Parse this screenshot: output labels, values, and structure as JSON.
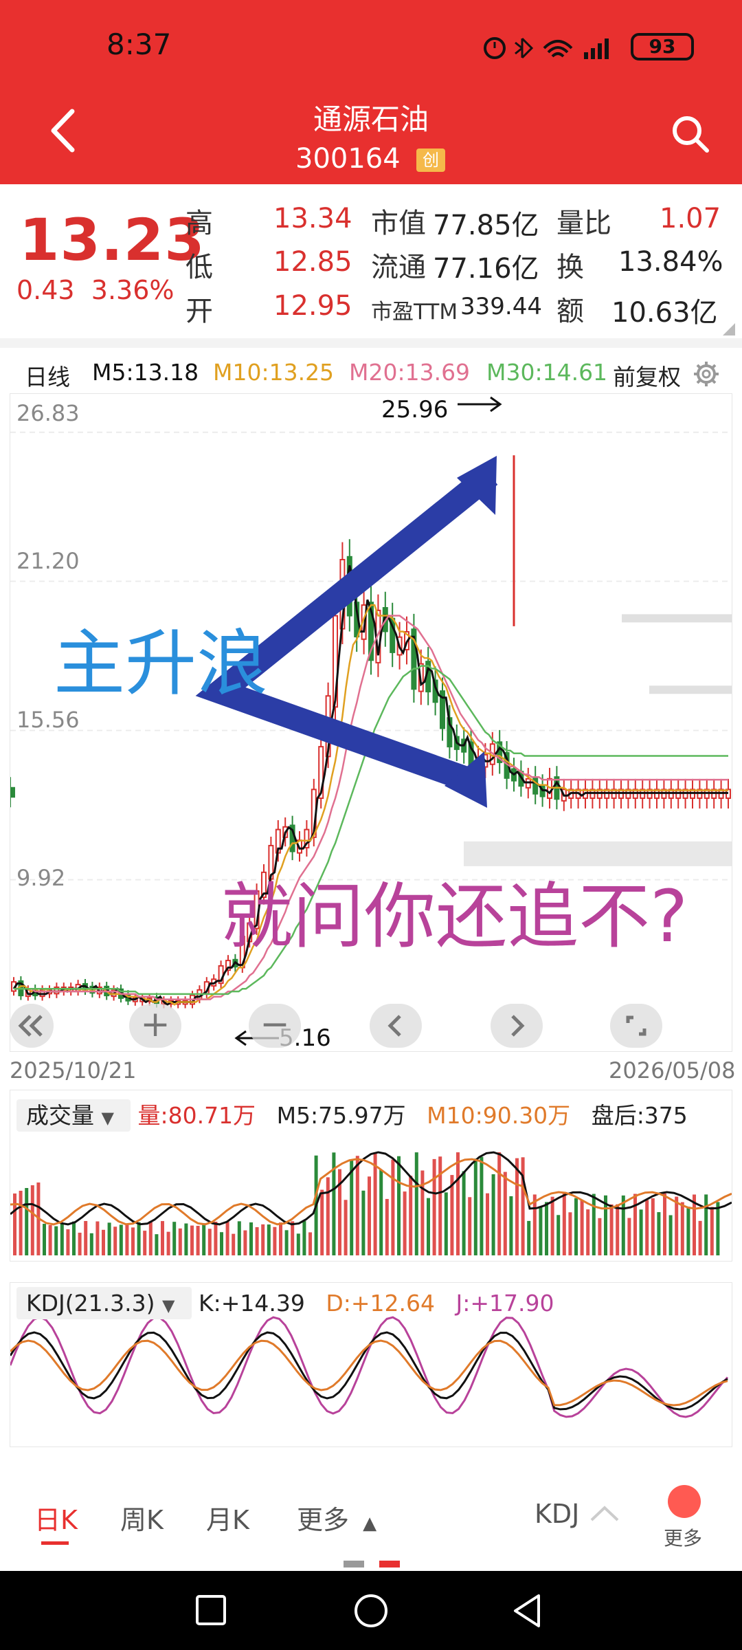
{
  "status": {
    "time": "8:37",
    "battery": "93"
  },
  "header": {
    "title": "通源石油",
    "code": "300164",
    "board_badge": "创"
  },
  "quote": {
    "price": "13.23",
    "change": "0.43",
    "change_pct": "3.36%",
    "high_label": "高",
    "high": "13.34",
    "low_label": "低",
    "low": "12.85",
    "open_label": "开",
    "open": "12.95",
    "mcap_label": "市值",
    "mcap": "77.85亿",
    "float_label": "流通",
    "float": "77.16亿",
    "pe_label": "市盈TTM",
    "pe": "339.44",
    "vol_ratio_label": "量比",
    "vol_ratio": "1.07",
    "turnover_label": "换",
    "turnover": "13.84%",
    "amount_label": "额",
    "amount": "10.63亿"
  },
  "ma_legend": {
    "period": "日线",
    "m5": "M5:13.18",
    "m10": "M10:13.25",
    "m20": "M20:13.69",
    "m30": "M30:14.61",
    "adjust": "前复权"
  },
  "colors": {
    "up": "#d9302e",
    "down": "#2a8a3a",
    "m5": "#111111",
    "m10": "#e0a020",
    "m20": "#e07090",
    "m30": "#5cb85c",
    "brand": "#e8302f"
  },
  "chart_data": {
    "type": "line",
    "title": "",
    "y_ticks": [
      "26.83",
      "21.20",
      "15.56",
      "9.92"
    ],
    "ylim": [
      5.0,
      27.5
    ],
    "x_start_label": "2025/10/21",
    "x_end_label": "2026/05/08",
    "high_marker": "25.96",
    "low_marker": "5.16",
    "annotations": [
      "主升浪",
      "就问你还追不?"
    ],
    "x": [
      0,
      5,
      10,
      15,
      20,
      25,
      30,
      35,
      40,
      45,
      50,
      55,
      60,
      65,
      70,
      75,
      80,
      85,
      90,
      95,
      100,
      105,
      110,
      115,
      120,
      125,
      130,
      135,
      140,
      145,
      150,
      155,
      160,
      165,
      170,
      175,
      180,
      185,
      190,
      195,
      200,
      205,
      210,
      215,
      220,
      225,
      230,
      235,
      240,
      245,
      250,
      255,
      260,
      265,
      270,
      275,
      280,
      285,
      290,
      295,
      300,
      305,
      310,
      315,
      320,
      325,
      330,
      335,
      340,
      345,
      350,
      355,
      360,
      365,
      370,
      375,
      380,
      385,
      390,
      395,
      400,
      405,
      410,
      415,
      420,
      425,
      430,
      435,
      440,
      445,
      450,
      455,
      460,
      465,
      470,
      475,
      480,
      485,
      490,
      495,
      500,
      505,
      510,
      515,
      520,
      525,
      530,
      535,
      540,
      545,
      550,
      555,
      560,
      565,
      570,
      575,
      580,
      585,
      590,
      595,
      600,
      605,
      610,
      615,
      620,
      625,
      630,
      635,
      640,
      645,
      650,
      655,
      660,
      665,
      670,
      675,
      680,
      685,
      690,
      695,
      700,
      705,
      710,
      715,
      720,
      725,
      730,
      735,
      740,
      745,
      750,
      755,
      760,
      765,
      770,
      775,
      780,
      785,
      790,
      795,
      800,
      805,
      810,
      815,
      820,
      825,
      830,
      835,
      840,
      845,
      850,
      855,
      860,
      865,
      870,
      875,
      880,
      885,
      890,
      895,
      900,
      905,
      910,
      915,
      920,
      925,
      930,
      935,
      940,
      945,
      950,
      955,
      960,
      965,
      970,
      975,
      980,
      985,
      990,
      995,
      1000
    ],
    "series": [
      {
        "name": "M5:13.18",
        "color": "#111111",
        "values": [
          5.8,
          6.0,
          6.0,
          5.9,
          5.6,
          5.6,
          5.7,
          5.6,
          5.6,
          5.6,
          5.7,
          5.7,
          5.7,
          5.7,
          5.8,
          5.7,
          5.8,
          5.8,
          5.8,
          5.9,
          5.9,
          5.8,
          5.8,
          5.9,
          5.7,
          5.7,
          5.8,
          5.6,
          5.6,
          5.8,
          5.7,
          5.5,
          5.5,
          5.4,
          5.4,
          5.5,
          5.4,
          5.3,
          5.4,
          5.3,
          5.4,
          5.5,
          5.3,
          5.2,
          5.3,
          5.3,
          5.3,
          5.3,
          5.3,
          5.3,
          5.3,
          5.5,
          5.5,
          5.6,
          5.7,
          6.0,
          6.0,
          6.1,
          6.1,
          6.4,
          6.6,
          6.6,
          6.8,
          6.7,
          6.7,
          7.1,
          7.7,
          8.1,
          8.2,
          9.2,
          9.4,
          9.4,
          10.1,
          10.2,
          11.1,
          11.1,
          11.7,
          11.9,
          11.8,
          11.4,
          11.1,
          11.1,
          11.3,
          11.4,
          11.7,
          13.0,
          13.2,
          13.9,
          14.8,
          16.0,
          16.7,
          18.3,
          19.7,
          21.0,
          21.8,
          21.2,
          20.1,
          19.3,
          19.3,
          20.5,
          20.1,
          19.6,
          18.4,
          19.4,
          19.9,
          19.8,
          19.5,
          19.2,
          18.7,
          18.5,
          18.9,
          19.1,
          19.1,
          18.4,
          17.3,
          17.4,
          17.9,
          17.8,
          17.2,
          16.9,
          16.8,
          16.8,
          15.8,
          15.6,
          15.1,
          15.0,
          15.0,
          15.3,
          14.9,
          14.7,
          14.3,
          14.6,
          14.4,
          14.4,
          14.5,
          14.7,
          14.9,
          14.8,
          14.5,
          14.0,
          13.9,
          14.0,
          13.8,
          13.6,
          13.6,
          13.6,
          13.6,
          13.5,
          13.3,
          13.3,
          13.2,
          13.4,
          13.6,
          13.4,
          13.1,
          13.1,
          13.2,
          13.2,
          13.2,
          13.1,
          13.2,
          13.2,
          13.2,
          13.2,
          13.2,
          13.2,
          13.2,
          13.2,
          13.2,
          13.2,
          13.2,
          13.2,
          13.2,
          13.2,
          13.2,
          13.2,
          13.2,
          13.2,
          13.2,
          13.2,
          13.2,
          13.2,
          13.2,
          13.2,
          13.2,
          13.2,
          13.2,
          13.2,
          13.2,
          13.2,
          13.2,
          13.2,
          13.2,
          13.2,
          13.2,
          13.2,
          13.2,
          13.2,
          13.2,
          13.2,
          13.2,
          13.2,
          13.2,
          13.18
        ]
      },
      {
        "name": "M10:13.25",
        "color": "#e0a020",
        "values": [
          5.8,
          5.8,
          5.9,
          5.9,
          5.8,
          5.7,
          5.8,
          5.7,
          5.7,
          5.8,
          5.7,
          5.7,
          5.7,
          5.7,
          5.7,
          5.8,
          5.7,
          5.7,
          5.7,
          5.8,
          5.7,
          5.8,
          5.7,
          5.8,
          5.8,
          5.8,
          5.7,
          5.6,
          5.6,
          5.6,
          5.6,
          5.6,
          5.5,
          5.5,
          5.5,
          5.5,
          5.5,
          5.4,
          5.4,
          5.3,
          5.3,
          5.4,
          5.4,
          5.3,
          5.3,
          5.2,
          5.3,
          5.3,
          5.3,
          5.3,
          5.3,
          5.3,
          5.4,
          5.4,
          5.4,
          5.5,
          5.6,
          5.7,
          5.8,
          5.9,
          6.1,
          6.2,
          6.4,
          6.6,
          6.6,
          6.8,
          7.1,
          7.4,
          7.6,
          8.1,
          8.5,
          8.8,
          9.1,
          9.5,
          10.1,
          10.4,
          10.8,
          11.1,
          11.3,
          11.3,
          11.4,
          11.4,
          11.4,
          11.4,
          11.6,
          11.9,
          12.2,
          12.6,
          13.1,
          13.8,
          14.4,
          15.2,
          16.1,
          17.2,
          18.1,
          18.8,
          19.0,
          19.4,
          19.8,
          20.1,
          20.3,
          20.3,
          19.9,
          19.9,
          19.9,
          19.9,
          19.8,
          19.6,
          19.3,
          19.3,
          19.2,
          19.1,
          19.0,
          18.7,
          18.4,
          18.3,
          18.3,
          18.2,
          17.9,
          17.6,
          17.4,
          17.2,
          16.8,
          16.4,
          16.1,
          15.8,
          15.6,
          15.5,
          15.3,
          15.1,
          14.9,
          14.8,
          14.7,
          14.7,
          14.6,
          14.6,
          14.6,
          14.5,
          14.4,
          14.3,
          14.2,
          14.1,
          14.0,
          13.9,
          13.8,
          13.7,
          13.6,
          13.5,
          13.5,
          13.5,
          13.4,
          13.4,
          13.4,
          13.4,
          13.4,
          13.3,
          13.3,
          13.3,
          13.3,
          13.3,
          13.3,
          13.3,
          13.3,
          13.3,
          13.3,
          13.3,
          13.3,
          13.3,
          13.3,
          13.3,
          13.3,
          13.3,
          13.3,
          13.3,
          13.3,
          13.3,
          13.3,
          13.3,
          13.3,
          13.3,
          13.3,
          13.3,
          13.3,
          13.3,
          13.3,
          13.3,
          13.3,
          13.3,
          13.3,
          13.3,
          13.3,
          13.3,
          13.3,
          13.3,
          13.3,
          13.3,
          13.3,
          13.3,
          13.3,
          13.3,
          13.3,
          13.3,
          13.3,
          13.3,
          13.3,
          13.3,
          13.25
        ]
      },
      {
        "name": "M20:13.69",
        "color": "#e07090",
        "values": [
          5.8,
          5.8,
          5.8,
          5.8,
          5.8,
          5.8,
          5.7,
          5.7,
          5.7,
          5.7,
          5.7,
          5.7,
          5.7,
          5.7,
          5.7,
          5.7,
          5.7,
          5.7,
          5.7,
          5.7,
          5.7,
          5.7,
          5.7,
          5.7,
          5.7,
          5.7,
          5.7,
          5.7,
          5.7,
          5.7,
          5.6,
          5.6,
          5.6,
          5.6,
          5.6,
          5.5,
          5.5,
          5.5,
          5.5,
          5.5,
          5.4,
          5.4,
          5.4,
          5.4,
          5.4,
          5.4,
          5.4,
          5.4,
          5.4,
          5.4,
          5.4,
          5.4,
          5.4,
          5.4,
          5.4,
          5.4,
          5.5,
          5.5,
          5.5,
          5.6,
          5.7,
          5.7,
          5.8,
          5.9,
          6.0,
          6.1,
          6.3,
          6.4,
          6.6,
          6.8,
          7.0,
          7.3,
          7.5,
          7.8,
          8.1,
          8.4,
          8.7,
          9.1,
          9.4,
          9.7,
          10.0,
          10.2,
          10.4,
          10.6,
          10.8,
          11.1,
          11.4,
          11.7,
          12.1,
          12.6,
          13.0,
          13.5,
          14.1,
          14.8,
          15.5,
          16.1,
          16.6,
          17.2,
          17.7,
          18.2,
          18.6,
          18.9,
          19.2,
          19.5,
          19.7,
          19.9,
          19.9,
          19.9,
          19.9,
          19.8,
          19.7,
          19.6,
          19.5,
          19.4,
          19.2,
          19.0,
          18.8,
          18.6,
          18.3,
          18.0,
          17.7,
          17.4,
          17.1,
          16.8,
          16.5,
          16.2,
          16.0,
          15.8,
          15.6,
          15.4,
          15.2,
          15.1,
          14.9,
          14.8,
          14.7,
          14.6,
          14.5,
          14.4,
          14.3,
          14.2,
          14.2,
          14.1,
          14.0,
          13.9,
          13.9,
          13.8,
          13.8,
          13.8,
          13.7,
          13.7,
          13.7,
          13.7,
          13.7,
          13.7,
          13.7,
          13.7,
          13.7,
          13.7,
          13.7,
          13.7,
          13.7,
          13.7,
          13.7,
          13.7,
          13.7,
          13.7,
          13.7,
          13.7,
          13.7,
          13.7,
          13.7,
          13.7,
          13.7,
          13.7,
          13.7,
          13.7,
          13.7,
          13.7,
          13.7,
          13.7,
          13.7,
          13.7,
          13.7,
          13.7,
          13.7,
          13.7,
          13.7,
          13.7,
          13.7,
          13.7,
          13.7,
          13.7,
          13.7,
          13.7,
          13.7,
          13.7,
          13.7,
          13.7,
          13.7,
          13.7,
          13.7,
          13.7,
          13.7,
          13.7,
          13.7,
          13.7,
          13.69
        ]
      },
      {
        "name": "M30:14.61",
        "color": "#5cb85c",
        "values": [
          5.8,
          5.8,
          5.8,
          5.8,
          5.8,
          5.8,
          5.8,
          5.8,
          5.8,
          5.8,
          5.8,
          5.8,
          5.8,
          5.8,
          5.8,
          5.8,
          5.8,
          5.8,
          5.8,
          5.8,
          5.8,
          5.8,
          5.8,
          5.8,
          5.8,
          5.8,
          5.8,
          5.8,
          5.8,
          5.8,
          5.7,
          5.7,
          5.7,
          5.7,
          5.7,
          5.6,
          5.6,
          5.6,
          5.6,
          5.6,
          5.6,
          5.6,
          5.6,
          5.6,
          5.6,
          5.6,
          5.6,
          5.6,
          5.6,
          5.6,
          5.6,
          5.6,
          5.6,
          5.6,
          5.6,
          5.6,
          5.6,
          5.6,
          5.6,
          5.6,
          5.6,
          5.7,
          5.7,
          5.7,
          5.8,
          5.8,
          5.9,
          6.0,
          6.1,
          6.2,
          6.3,
          6.5,
          6.6,
          6.8,
          7.0,
          7.2,
          7.4,
          7.6,
          7.8,
          8.1,
          8.3,
          8.6,
          8.8,
          9.1,
          9.4,
          9.7,
          10.0,
          10.3,
          10.6,
          11.0,
          11.3,
          11.7,
          12.1,
          12.5,
          12.9,
          13.3,
          13.7,
          14.1,
          14.5,
          14.9,
          15.2,
          15.6,
          15.9,
          16.2,
          16.5,
          16.8,
          17.0,
          17.2,
          17.4,
          17.6,
          17.7,
          17.8,
          17.9,
          17.9,
          18.0,
          18.0,
          18.0,
          17.9,
          17.9,
          17.8,
          17.7,
          17.6,
          17.5,
          17.3,
          17.1,
          16.9,
          16.7,
          16.5,
          16.3,
          16.1,
          15.9,
          15.7,
          15.5,
          15.4,
          15.2,
          15.1,
          15.0,
          14.9,
          14.8,
          14.8,
          14.7,
          14.7,
          14.7,
          14.6,
          14.6,
          14.6,
          14.6,
          14.6,
          14.6,
          14.6,
          14.6,
          14.6,
          14.6,
          14.6,
          14.6,
          14.6,
          14.6,
          14.6,
          14.6,
          14.6,
          14.6,
          14.6,
          14.6,
          14.6,
          14.6,
          14.6,
          14.6,
          14.6,
          14.6,
          14.6,
          14.6,
          14.6,
          14.6,
          14.6,
          14.6,
          14.6,
          14.6,
          14.6,
          14.6,
          14.6,
          14.6,
          14.6,
          14.6,
          14.6,
          14.6,
          14.6,
          14.6,
          14.6,
          14.6,
          14.6,
          14.6,
          14.6,
          14.6,
          14.6,
          14.6,
          14.6,
          14.6,
          14.6,
          14.6,
          14.6,
          14.6,
          14.6,
          14.6,
          14.6,
          14.6,
          14.6,
          14.61
        ]
      }
    ]
  },
  "chart_controls": {
    "zoom_in": "+",
    "zoom_out": "−"
  },
  "volume": {
    "selector": "成交量",
    "current": "量:80.71万",
    "m5": "M5:75.97万",
    "m10": "M10:90.30万",
    "after_hours": "盘后:375"
  },
  "kdj": {
    "selector": "KDJ(21.3.3)",
    "k": "K:+14.39",
    "d": "D:+12.64",
    "j": "J:+17.90"
  },
  "bottom_tabs": [
    "日K",
    "周K",
    "月K",
    "更多"
  ],
  "indicator_tab": "KDJ",
  "more_label": "更多"
}
